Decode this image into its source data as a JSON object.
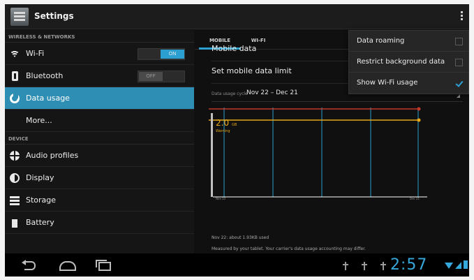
{
  "app": {
    "title": "Settings"
  },
  "sidebar": {
    "sections": [
      {
        "header": "WIRELESS & NETWORKS"
      },
      {
        "header": "DEVICE"
      }
    ],
    "items": [
      {
        "label": "Wi-Fi",
        "icon": "wifi-icon",
        "toggle": "ON"
      },
      {
        "label": "Bluetooth",
        "icon": "bluetooth-icon",
        "toggle": "OFF"
      },
      {
        "label": "Data usage",
        "icon": "data-usage-icon",
        "selected": true
      },
      {
        "label": "More..."
      },
      {
        "label": "Audio profiles",
        "icon": "audio-profiles-icon"
      },
      {
        "label": "Display",
        "icon": "display-icon"
      },
      {
        "label": "Storage",
        "icon": "storage-icon"
      },
      {
        "label": "Battery",
        "icon": "battery-icon"
      }
    ]
  },
  "tabs": [
    {
      "label": "MOBILE",
      "active": true
    },
    {
      "label": "WI-FI",
      "active": false
    }
  ],
  "main": {
    "mobile_data": "Mobile data",
    "set_limit": "Set mobile data limit",
    "cycle_prefix": "Data usage cycle",
    "cycle_value": "Nov 22 – Dec 21",
    "footer_line1": "Nov 22: about 1.93KB used",
    "footer_line2": "Measured by your tablet. Your carrier's data usage accounting may differ."
  },
  "chart_data": {
    "type": "line",
    "x_start_label": "Nov 22",
    "x_end_label": "Dec 21",
    "limit_value": "2.0",
    "limit_unit": "GB",
    "warning_label": "Warning",
    "colors": {
      "limit": "#c0392b",
      "warning": "#e6a817",
      "grid": "#2a9fd0",
      "usage": "#ffffff"
    }
  },
  "overflow_menu": [
    {
      "label": "Data roaming",
      "checked": false
    },
    {
      "label": "Restrict background data",
      "checked": false
    },
    {
      "label": "Show Wi-Fi usage",
      "checked": true
    }
  ],
  "statusbar": {
    "time": "2:57"
  }
}
